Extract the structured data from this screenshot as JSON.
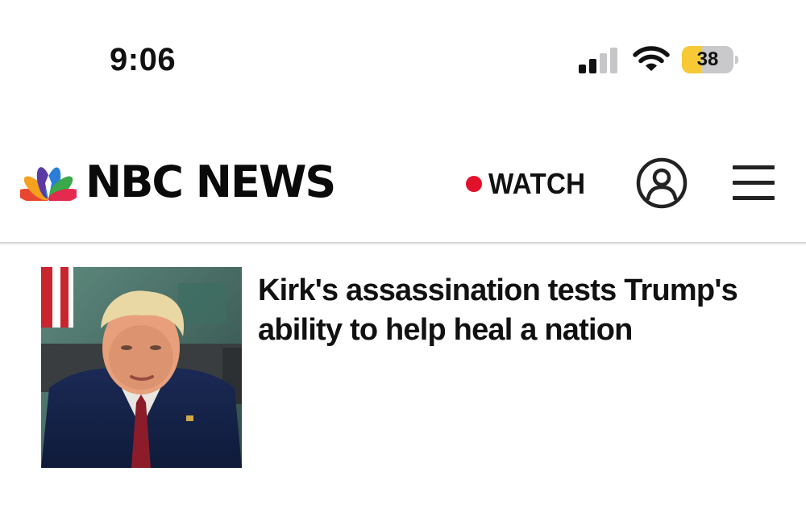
{
  "status_bar": {
    "time": "9:06",
    "battery_level": "38",
    "battery_fraction": 0.38,
    "signal_bars_active": 2,
    "signal_bars_total": 4,
    "battery_color": "#f6c935"
  },
  "header": {
    "logo_text": "NBC NEWS",
    "watch_label": "WATCH",
    "live_dot_color": "#e3122b",
    "icons": [
      "nbc-peacock-icon",
      "live-dot-icon",
      "account-icon",
      "menu-icon"
    ]
  },
  "article": {
    "headline": "Kirk's assassination tests Trump's ability to help heal a nation"
  }
}
